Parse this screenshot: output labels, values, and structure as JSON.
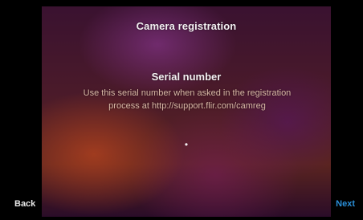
{
  "screen": {
    "title": "Camera registration",
    "heading": "Serial number",
    "description": "Use this serial number when asked in the registration process at http://support.flir.com/camreg",
    "serial_value": "•"
  },
  "nav": {
    "back_label": "Back",
    "next_label": "Next"
  },
  "colors": {
    "accent": "#2a8fd8",
    "text_primary": "#f2eef0",
    "text_secondary": "#d9b9a6"
  }
}
